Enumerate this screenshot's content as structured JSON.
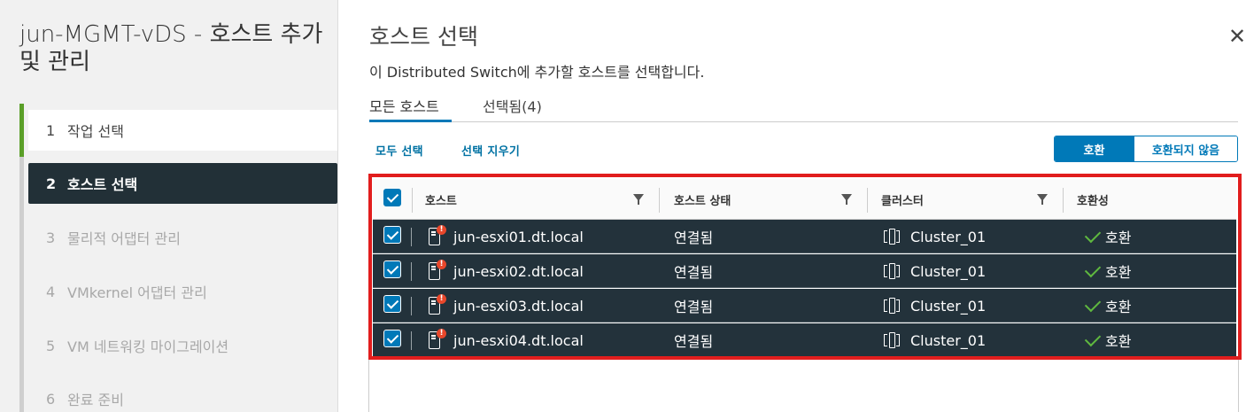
{
  "wizard": {
    "title": "jun-MGMT-vDS - 호스트 추가 및 관리",
    "steps": [
      {
        "num": "1",
        "label": "작업 선택",
        "state": "done"
      },
      {
        "num": "2",
        "label": "호스트 선택",
        "state": "current"
      },
      {
        "num": "3",
        "label": "물리적 어댑터 관리",
        "state": "future"
      },
      {
        "num": "4",
        "label": "VMkernel 어댑터 관리",
        "state": "future"
      },
      {
        "num": "5",
        "label": "VM 네트워킹 마이그레이션",
        "state": "future"
      },
      {
        "num": "6",
        "label": "완료 준비",
        "state": "future"
      }
    ]
  },
  "page": {
    "title": "호스트 선택",
    "description": "이 Distributed Switch에 추가할 호스트를 선택합니다.",
    "close_icon": "close-icon"
  },
  "tabs": [
    {
      "label": "모든 호스트",
      "active": true
    },
    {
      "label": "선택됨(4)",
      "active": false
    }
  ],
  "actions": {
    "select_all": "모두 선택",
    "clear_selection": "선택 지우기"
  },
  "filter_toggle": {
    "compatible": "호환",
    "incompatible": "호환되지 않음",
    "selected": "호환"
  },
  "grid": {
    "columns": [
      "호스트",
      "호스트 상태",
      "클러스터",
      "호환성"
    ],
    "rows": [
      {
        "host": "jun-esxi01.dt.local",
        "status": "연결됨",
        "cluster": "Cluster_01",
        "compatibility": "호환",
        "checked": true
      },
      {
        "host": "jun-esxi02.dt.local",
        "status": "연결됨",
        "cluster": "Cluster_01",
        "compatibility": "호환",
        "checked": true
      },
      {
        "host": "jun-esxi03.dt.local",
        "status": "연결됨",
        "cluster": "Cluster_01",
        "compatibility": "호환",
        "checked": true
      },
      {
        "host": "jun-esxi04.dt.local",
        "status": "연결됨",
        "cluster": "Cluster_01",
        "compatibility": "호환",
        "checked": true
      }
    ]
  },
  "colors": {
    "accent": "#0079b8",
    "selected_row": "#23323b",
    "highlight": "#e11d1d",
    "step_progress": "#5a9f28",
    "ok": "#5fb83f"
  }
}
